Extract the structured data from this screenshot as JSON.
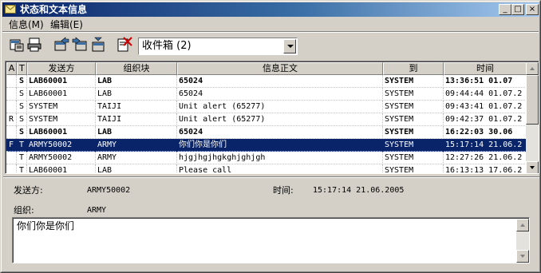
{
  "window": {
    "title": "状态和文本信息",
    "minimize": "_",
    "maximize": "□",
    "close": "×"
  },
  "menu": {
    "info": "信息(M)",
    "edit": "编辑(E)"
  },
  "toolbar": {
    "folder_selected": "收件箱 (2)"
  },
  "list": {
    "headers": {
      "a": "A",
      "t": "T",
      "sender": "发送方",
      "group": "组织块",
      "body": "信息正文",
      "to": "到",
      "time": "时间"
    },
    "rows": [
      {
        "a": "",
        "t": "S",
        "sender": "LAB60001",
        "group": "LAB",
        "body": "65024",
        "to": "SYSTEM",
        "time": "13:36:51 01.07",
        "bold": true,
        "selected": false
      },
      {
        "a": "",
        "t": "S",
        "sender": "LAB60001",
        "group": "LAB",
        "body": "65024",
        "to": "SYSTEM",
        "time": "09:44:44 01.07.2",
        "bold": false,
        "selected": false
      },
      {
        "a": "",
        "t": "S",
        "sender": "SYSTEM",
        "group": "TAIJI",
        "body": "Unit alert (65277)",
        "to": "SYSTEM",
        "time": "09:43:41 01.07.2",
        "bold": false,
        "selected": false
      },
      {
        "a": "R",
        "t": "S",
        "sender": "SYSTEM",
        "group": "TAIJI",
        "body": "Unit alert (65277)",
        "to": "SYSTEM",
        "time": "09:42:37 01.07.2",
        "bold": false,
        "selected": false
      },
      {
        "a": "",
        "t": "S",
        "sender": "LAB60001",
        "group": "LAB",
        "body": "65024",
        "to": "SYSTEM",
        "time": "16:22:03 30.06",
        "bold": true,
        "selected": false
      },
      {
        "a": "F",
        "t": "T",
        "sender": "ARMY50002",
        "group": "ARMY",
        "body": "你们你是你们",
        "to": "SYSTEM",
        "time": "15:17:14 21.06.2",
        "bold": false,
        "selected": true
      },
      {
        "a": "",
        "t": "T",
        "sender": "ARMY50002",
        "group": "ARMY",
        "body": "hjgjhgjhgkghjghjgh",
        "to": "SYSTEM",
        "time": "12:27:26 21.06.2",
        "bold": false,
        "selected": false
      },
      {
        "a": "",
        "t": "T",
        "sender": "LAB60001",
        "group": "LAB",
        "body": "Please call",
        "to": "SYSTEM",
        "time": "16:13:13 17.06.2",
        "bold": false,
        "selected": false
      }
    ]
  },
  "detail": {
    "sender_label": "发送方:",
    "sender_value": "ARMY50002",
    "time_label": "时间:",
    "time_value": "15:17:14 21.06.2005",
    "org_label": "组织:",
    "org_value": "ARMY",
    "message_text": "你们你是你们"
  },
  "colors": {
    "title_start": "#0a246a",
    "title_end": "#a6caf0",
    "selection": "#0a246a",
    "face": "#d4d0c8"
  }
}
